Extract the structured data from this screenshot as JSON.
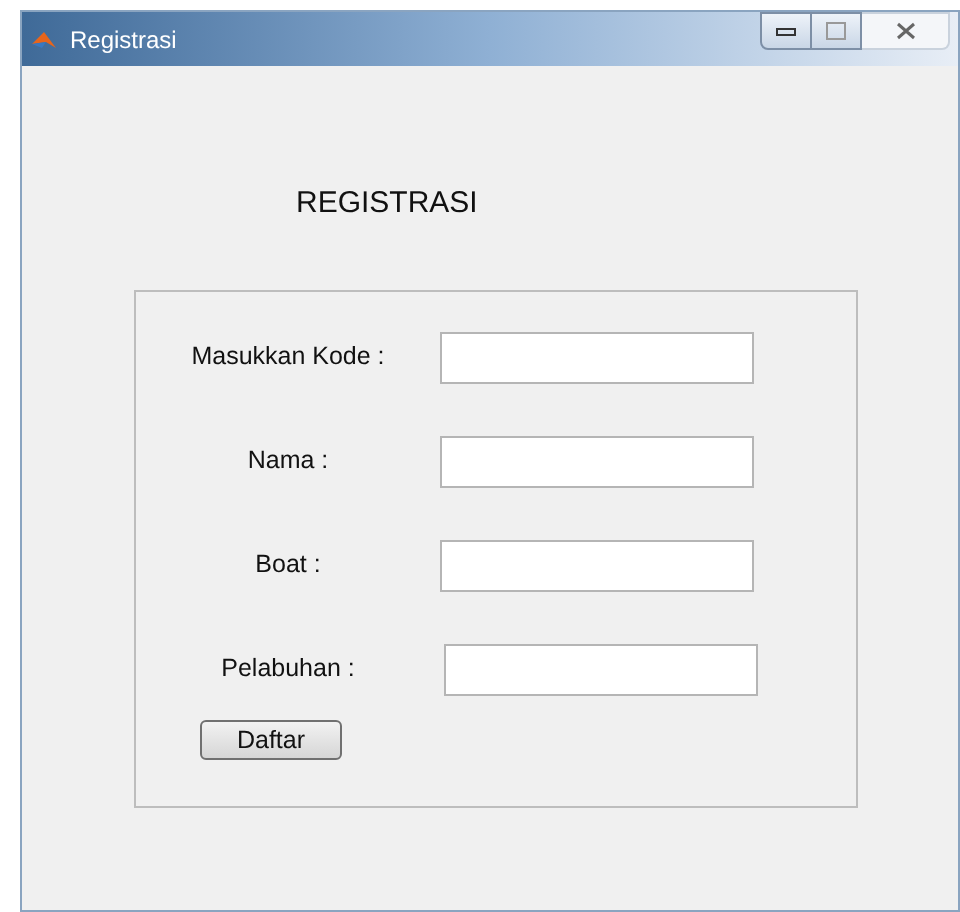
{
  "window": {
    "title": "Registrasi"
  },
  "heading": "REGISTRASI",
  "fields": [
    {
      "label": "Masukkan Kode :"
    },
    {
      "label": "Nama :"
    },
    {
      "label": "Boat :"
    },
    {
      "label": "Pelabuhan :"
    }
  ],
  "button": "Daftar"
}
